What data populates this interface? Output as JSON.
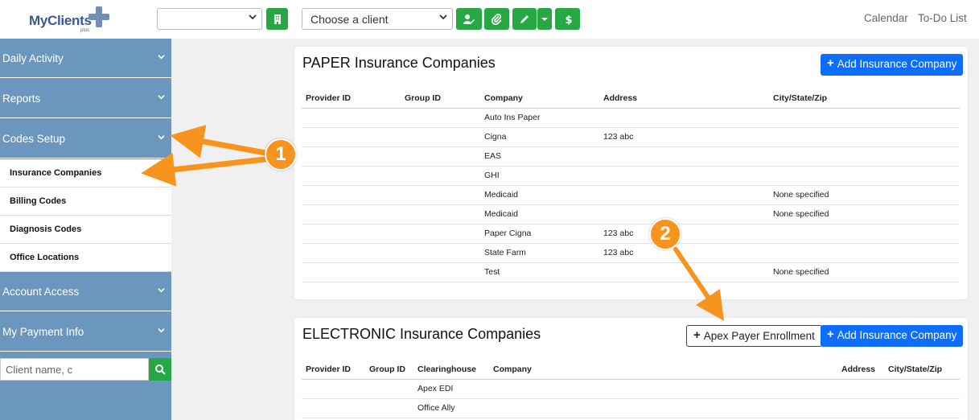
{
  "app": {
    "logo_text": "MyClients",
    "logo_sub": "plus"
  },
  "toolbar": {
    "client_select_placeholder": "Choose a client",
    "links": [
      "Calendar",
      "To-Do List"
    ]
  },
  "sidebar": {
    "items": [
      {
        "label": "Daily Activity"
      },
      {
        "label": "Reports"
      },
      {
        "label": "Codes Setup"
      }
    ],
    "sub_items": [
      {
        "label": "Insurance Companies"
      },
      {
        "label": "Billing Codes"
      },
      {
        "label": "Diagnosis Codes"
      },
      {
        "label": "Office Locations"
      }
    ],
    "items_after": [
      {
        "label": "Account Access"
      },
      {
        "label": "My Payment Info"
      }
    ],
    "search_placeholder": "Client name, c"
  },
  "paper": {
    "title": "PAPER Insurance Companies",
    "add_label": "Add Insurance Company",
    "headers": [
      "Provider ID",
      "Group ID",
      "Company",
      "Address",
      "City/State/Zip"
    ],
    "rows": [
      [
        "",
        "",
        "Auto Ins Paper",
        "",
        ""
      ],
      [
        "",
        "",
        "Cigna",
        "123 abc",
        ""
      ],
      [
        "",
        "",
        "EAS",
        "",
        ""
      ],
      [
        "",
        "",
        "GHI",
        "",
        ""
      ],
      [
        "",
        "",
        "Medicaid",
        "",
        "None specified"
      ],
      [
        "",
        "",
        "Medicaid",
        "",
        "None specified"
      ],
      [
        "",
        "",
        "Paper Cigna",
        "123 abc",
        ""
      ],
      [
        "",
        "",
        "State Farm",
        "123 abc",
        ""
      ],
      [
        "",
        "",
        "Test",
        "",
        "None specified"
      ]
    ]
  },
  "electronic": {
    "title": "ELECTRONIC Insurance Companies",
    "apex_label": "Apex Payer Enrollment",
    "add_label": "Add Insurance Company",
    "headers": [
      "Provider ID",
      "Group ID",
      "Clearinghouse",
      "Company",
      "Address",
      "City/State/Zip"
    ],
    "rows": [
      [
        "",
        "",
        "Apex EDI",
        "",
        "",
        ""
      ],
      [
        "",
        "",
        "Office Ally",
        "",
        "",
        ""
      ]
    ]
  },
  "annotations": {
    "badge_1": "1",
    "badge_2": "2"
  },
  "colors": {
    "sidebar": "#6b96be",
    "green": "#28a745",
    "blue": "#0d6efd",
    "orange": "#f7941d"
  }
}
